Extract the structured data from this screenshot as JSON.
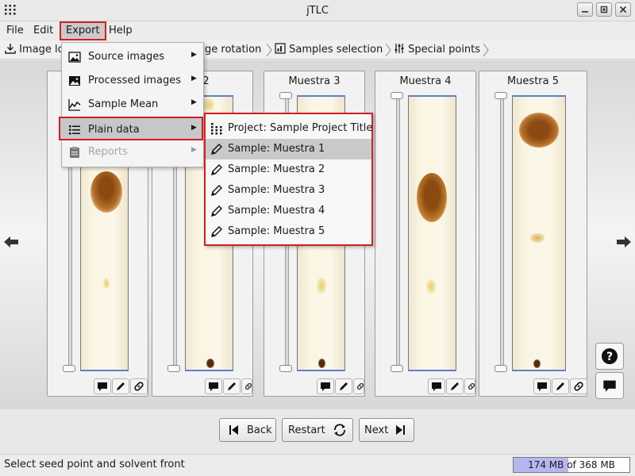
{
  "window": {
    "title": "jTLC",
    "buttons": [
      "minimize",
      "maximize",
      "close"
    ]
  },
  "menubar": {
    "items": [
      "File",
      "Edit",
      "Export",
      "Help"
    ],
    "active": "Export"
  },
  "steps": {
    "items": [
      {
        "label": "Image lo",
        "icon": "download-icon"
      },
      {
        "label": "ge rotation",
        "icon": ""
      },
      {
        "label": "Samples selection",
        "icon": "chart-icon"
      },
      {
        "label": "Special points",
        "icon": "sliders-icon"
      }
    ]
  },
  "samples": [
    {
      "title": "",
      "visible_title": false
    },
    {
      "title": "stra 2",
      "visible_title": true
    },
    {
      "title": "Muestra 3",
      "visible_title": true
    },
    {
      "title": "Muestra 4",
      "visible_title": true
    },
    {
      "title": "Muestra 5",
      "visible_title": true
    }
  ],
  "export_menu": {
    "items": [
      {
        "label": "Source images",
        "icon": "image-icon",
        "enabled": true,
        "has_submenu": true
      },
      {
        "label": "Processed images",
        "icon": "image-dark-icon",
        "enabled": true,
        "has_submenu": true
      },
      {
        "label": "Sample Mean",
        "icon": "line-chart-icon",
        "enabled": true,
        "has_submenu": true
      },
      {
        "label": "Plain data",
        "icon": "list-icon",
        "enabled": true,
        "has_submenu": true,
        "selected": true
      },
      {
        "label": "Reports",
        "icon": "clipboard-icon",
        "enabled": false,
        "has_submenu": true
      }
    ]
  },
  "plain_data_submenu": {
    "items": [
      {
        "label": "Project: Sample Project Title",
        "icon": "grid-dots-icon"
      },
      {
        "label": "Sample: Muestra 1",
        "icon": "pencil-icon",
        "selected": true
      },
      {
        "label": "Sample: Muestra 2",
        "icon": "pencil-icon"
      },
      {
        "label": "Sample: Muestra 3",
        "icon": "pencil-icon"
      },
      {
        "label": "Sample: Muestra 4",
        "icon": "pencil-icon"
      },
      {
        "label": "Sample: Muestra 5",
        "icon": "pencil-icon"
      }
    ]
  },
  "nav": {
    "back_label": "Back",
    "restart_label": "Restart",
    "next_label": "Next"
  },
  "status": {
    "message": "Select seed point and solvent front",
    "memory_used": "174 MB",
    "memory_of": "of 368 MB",
    "memory_fraction": 0.47
  },
  "colors": {
    "highlight_border": "#d21f1f",
    "solvent_line": "#5a82c8",
    "memory_fill": "#b8b5f0",
    "spot_dark": "#8a4a12",
    "spot_light": "#e8cf6a"
  }
}
